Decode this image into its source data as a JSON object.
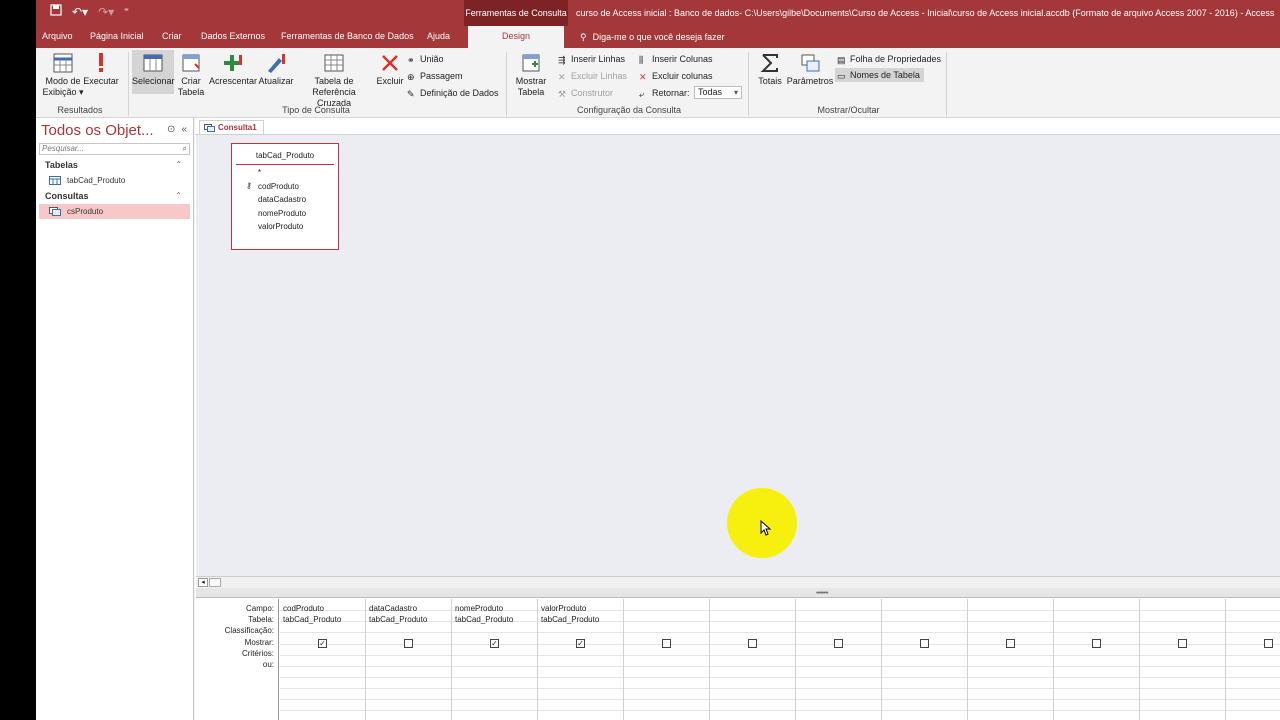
{
  "titlebar": {
    "tools_label": "Ferramentas de Consulta",
    "doc_title": "curso de Access inicial : Banco de dados- C:\\Users\\gilbe\\Documents\\Curso de Access - Inicial\\curso de Access inicial.accdb (Formato de arquivo Access 2007 - 2016)  -  Access"
  },
  "tabs": {
    "arquivo": "Arquivo",
    "pagina_inicial": "Página Inicial",
    "criar": "Criar",
    "dados_externos": "Dados Externos",
    "ferramentas": "Ferramentas de Banco de Dados",
    "ajuda": "Ajuda",
    "design": "Design",
    "tellme": "Diga-me o que você deseja fazer"
  },
  "ribbon": {
    "modo_exibicao": [
      "Modo de",
      "Exibição ▾"
    ],
    "executar": "Executar",
    "resultados": "Resultados",
    "selecionar": "Selecionar",
    "criar_tabela": [
      "Criar",
      "Tabela"
    ],
    "acrescentar": "Acrescentar",
    "atualizar": "Atualizar",
    "tabela_ref": [
      "Tabela de",
      "Referência Cruzada"
    ],
    "excluir": "Excluir",
    "uniao": "União",
    "passagem": "Passagem",
    "definicao": "Definição de Dados",
    "tipo_consulta": "Tipo de Consulta",
    "mostrar_tabela": [
      "Mostrar",
      "Tabela"
    ],
    "inserir_linhas": "Inserir Linhas",
    "excluir_linhas": "Excluir Linhas",
    "construtor": "Construtor",
    "inserir_colunas": "Inserir Colunas",
    "excluir_colunas": "Excluir colunas",
    "retornar": "Retornar:",
    "retornar_value": "Todas",
    "config_consulta": "Configuração da Consulta",
    "totais": "Totais",
    "parametros": "Parâmetros",
    "folha_prop": "Folha de Propriedades",
    "nomes_tabela": "Nomes de Tabela",
    "mostrar_ocultar": "Mostrar/Ocultar"
  },
  "nav": {
    "title": "Todos os Objet...",
    "search_placeholder": "Pesquisar...",
    "groups": [
      {
        "label": "Tabelas",
        "items": [
          "tabCad_Produto"
        ]
      },
      {
        "label": "Consultas",
        "items": [
          "csProduto"
        ]
      }
    ]
  },
  "document": {
    "tab_label": "Consulta1",
    "table": {
      "name": "tabCad_Produto",
      "fields": [
        "*",
        "codProduto",
        "dataCadastro",
        "nomeProduto",
        "valorProduto"
      ]
    }
  },
  "grid": {
    "row_labels": [
      "Campo:",
      "Tabela:",
      "Classificação:",
      "Mostrar:",
      "Critérios:",
      "ou:"
    ],
    "columns": [
      {
        "campo": "codProduto",
        "tabela": "tabCad_Produto",
        "mostrar": true
      },
      {
        "campo": "dataCadastro",
        "tabela": "tabCad_Produto",
        "mostrar": false
      },
      {
        "campo": "nomeProduto",
        "tabela": "tabCad_Produto",
        "mostrar": true
      },
      {
        "campo": "valorProduto",
        "tabela": "tabCad_Produto",
        "mostrar": true
      },
      {
        "campo": "",
        "tabela": "",
        "mostrar": false
      },
      {
        "campo": "",
        "tabela": "",
        "mostrar": false
      },
      {
        "campo": "",
        "tabela": "",
        "mostrar": false
      },
      {
        "campo": "",
        "tabela": "",
        "mostrar": false
      },
      {
        "campo": "",
        "tabela": "",
        "mostrar": false
      },
      {
        "campo": "",
        "tabela": "",
        "mostrar": false
      },
      {
        "campo": "",
        "tabela": "",
        "mostrar": false
      },
      {
        "campo": "",
        "tabela": "",
        "mostrar": false
      }
    ]
  },
  "colors": {
    "accent": "#a4373a",
    "selection": "#f8c8c9",
    "cursor_highlight": "#f7f00e"
  }
}
